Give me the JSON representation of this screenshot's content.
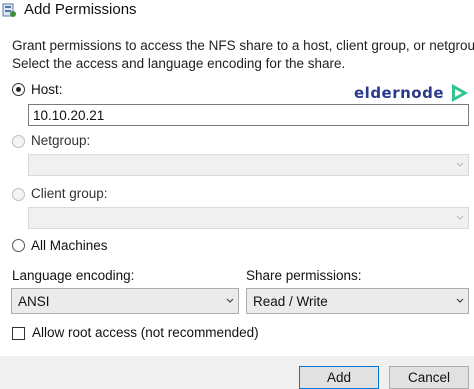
{
  "window": {
    "title": "Add Permissions"
  },
  "description": {
    "line1": "Grant permissions to access the NFS share to a host, client group, or netgroup.",
    "line2": "Select the access and language encoding for the share."
  },
  "logo": {
    "text": "eldernode",
    "color": "#2b3a8c",
    "accent": "#31c48d"
  },
  "options": {
    "host_label": "Host:",
    "host_value": "10.10.20.21",
    "netgroup_label": "Netgroup:",
    "client_group_label": "Client group:",
    "all_machines_label": "All Machines",
    "selected": "Host"
  },
  "encoding": {
    "label": "Language encoding:",
    "value": "ANSI"
  },
  "permissions": {
    "label": "Share permissions:",
    "value": "Read / Write"
  },
  "root_access": {
    "label": "Allow root access (not recommended)",
    "checked": false
  },
  "buttons": {
    "add": "Add",
    "cancel": "Cancel"
  }
}
